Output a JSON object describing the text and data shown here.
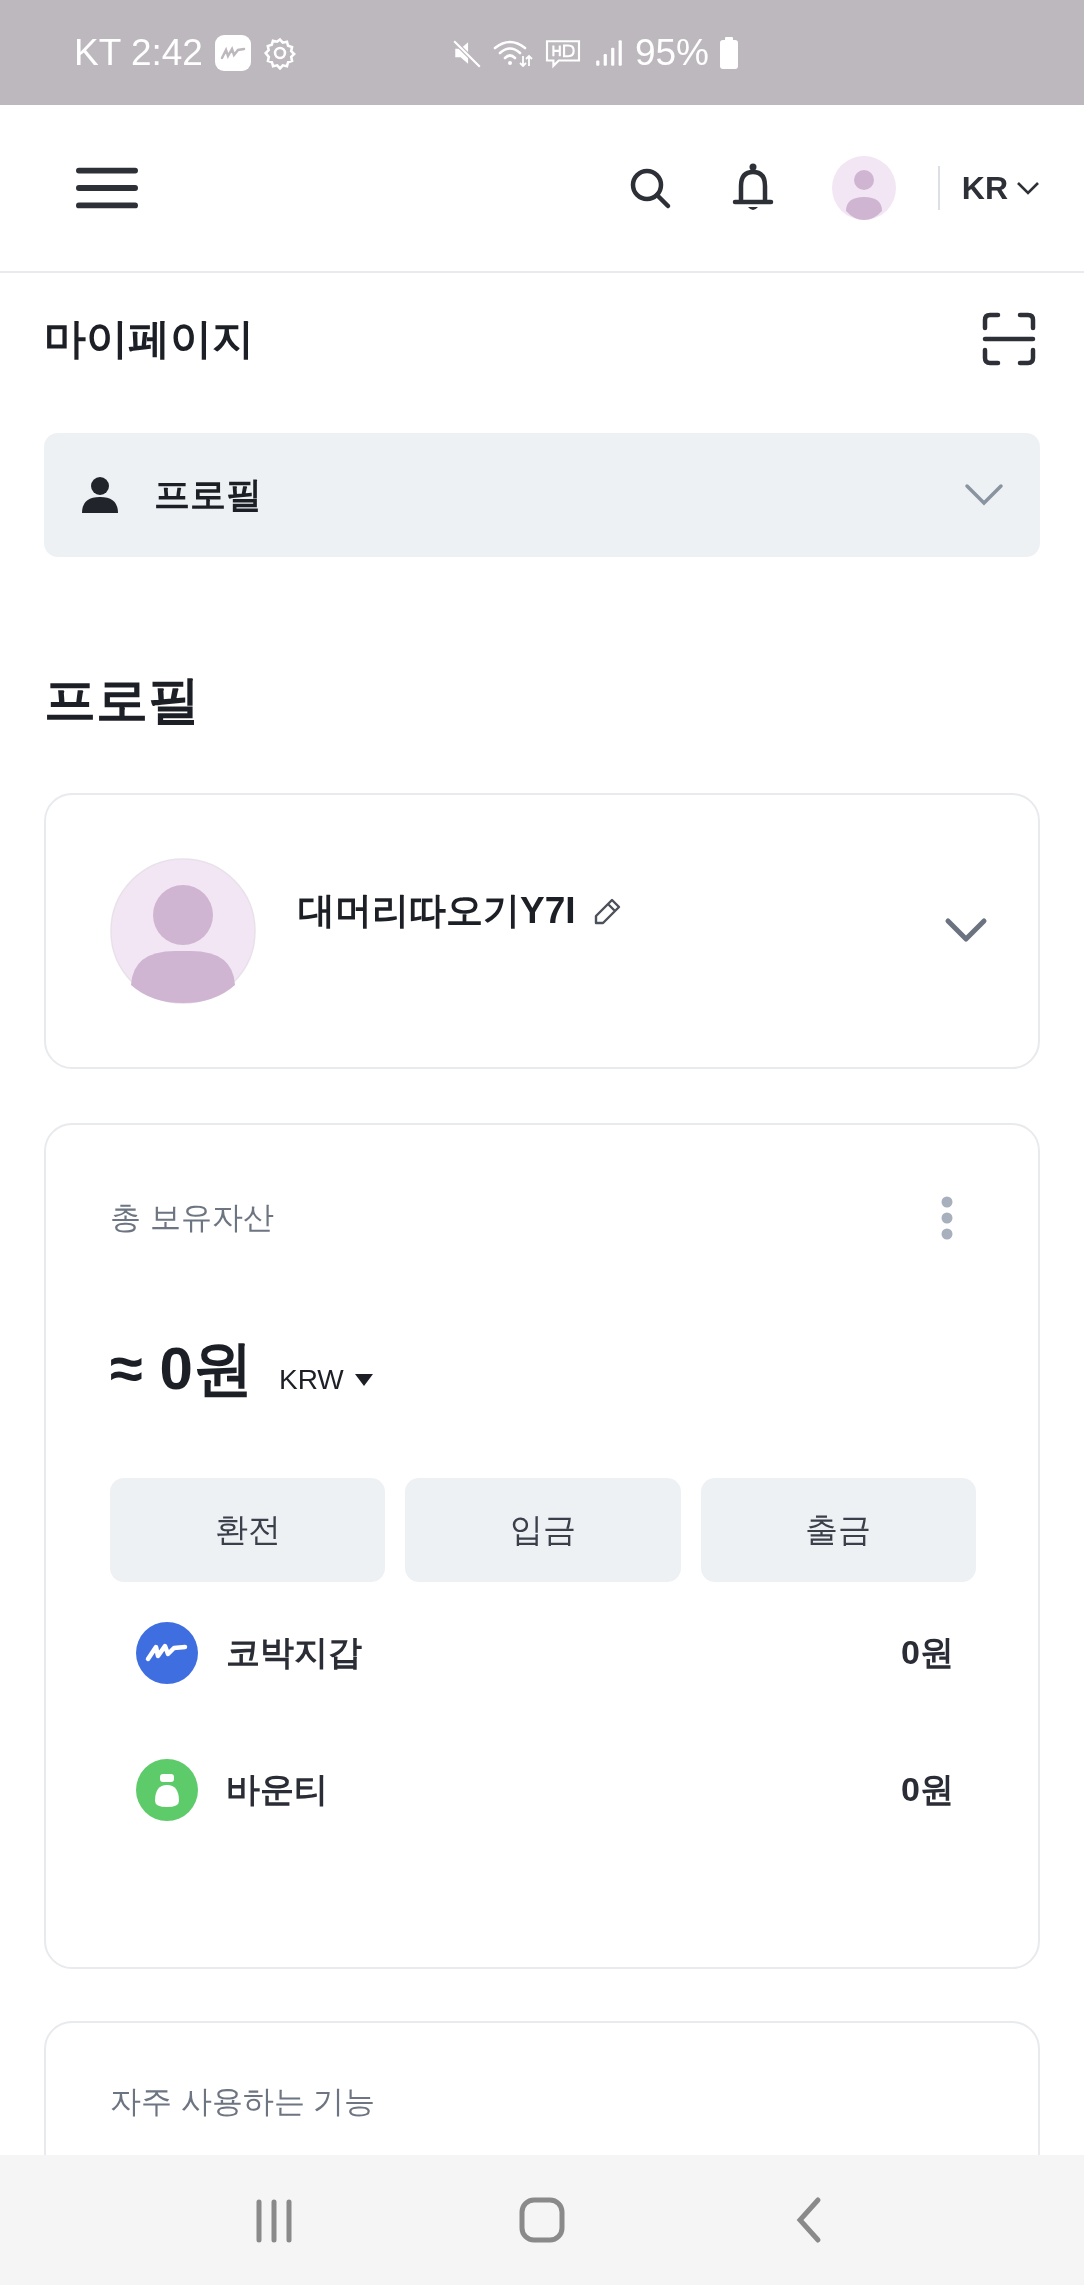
{
  "status_bar": {
    "carrier_time": "KT 2:42",
    "battery": "95%"
  },
  "header": {
    "language": "KR"
  },
  "page_title": "마이페이지",
  "section_dropdown": {
    "label": "프로필",
    "expanded": false
  },
  "section_heading": "프로필",
  "profile": {
    "name": "대머리따오기Y7I"
  },
  "assets": {
    "label": "총 보유자산",
    "total": "≈ 0원",
    "currency": "KRW",
    "actions": [
      "환전",
      "입금",
      "출금"
    ],
    "wallets": [
      {
        "kind": "kobak",
        "name": "코박지갑",
        "amount": "0원"
      },
      {
        "kind": "bounty",
        "name": "바운티",
        "amount": "0원"
      }
    ]
  },
  "next_card": {
    "title": "자주 사용하는 기능"
  }
}
